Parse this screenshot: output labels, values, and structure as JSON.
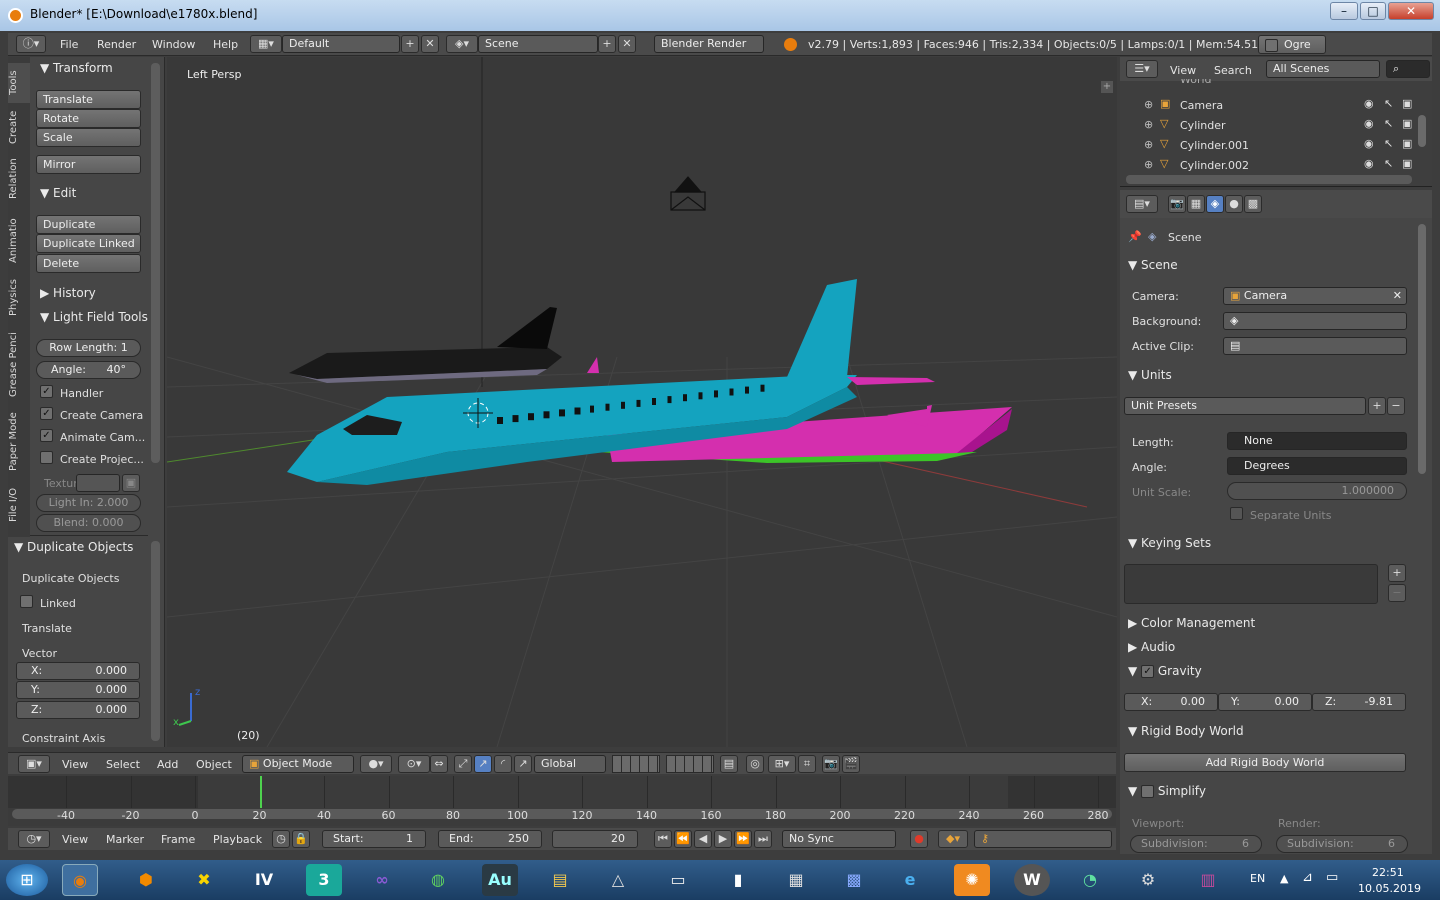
{
  "window": {
    "title": "Blender* [E:\\Download\\e1780x.blend]",
    "min": "–",
    "max": "□",
    "close": "✕"
  },
  "topbar": {
    "menus": [
      "File",
      "Render",
      "Window",
      "Help"
    ],
    "layout": "Default",
    "scene": "Scene",
    "engine": "Blender Render",
    "stats": "v2.79 | Verts:1,893 | Faces:946 | Tris:2,334 | Objects:0/5 | Lamps:0/1 | Mem:54.51M",
    "ogre": "Ogre"
  },
  "vtabs": [
    "Tools",
    "Create",
    "Relation",
    "Animatio",
    "Physics",
    "Grease Penci",
    "Paper Mode",
    "File I/O"
  ],
  "tools": {
    "transform_title": "Transform",
    "translate": "Translate",
    "rotate": "Rotate",
    "scale": "Scale",
    "mirror": "Mirror",
    "edit_title": "Edit",
    "duplicate": "Duplicate",
    "duplicate_linked": "Duplicate Linked",
    "delete": "Delete",
    "history_title": "History",
    "lightfield_title": "Light Field Tools",
    "row_length": "Row Length: 1",
    "angle": "Angle:",
    "angle_val": "40°",
    "handler": "Handler",
    "create_camera": "Create Camera",
    "animate_cam": "Animate Cam...",
    "create_projec": "Create Projec...",
    "textur": "Textur",
    "light_in": "Light In: 2.000",
    "blend": "Blend: 0.000"
  },
  "dup": {
    "title": "Duplicate Objects",
    "label": "Duplicate Objects",
    "linked": "Linked",
    "translate": "Translate",
    "vector": "Vector",
    "x": "X:",
    "xv": "0.000",
    "y": "Y:",
    "yv": "0.000",
    "z": "Z:",
    "zv": "0.000",
    "constraint": "Constraint Axis"
  },
  "viewport": {
    "persp": "Left Persp",
    "frame": "(20)",
    "axis_x": "x",
    "axis_z": "z"
  },
  "outliner": {
    "view": "View",
    "search": "Search",
    "all_scenes": "All Scenes",
    "world": "World",
    "items": [
      "Camera",
      "Cylinder",
      "Cylinder.001",
      "Cylinder.002"
    ]
  },
  "props": {
    "crumb": "Scene",
    "scene_title": "Scene",
    "camera_label": "Camera:",
    "camera_val": "Camera",
    "background": "Background:",
    "active_clip": "Active Clip:",
    "units_title": "Units",
    "unit_presets": "Unit Presets",
    "length": "Length:",
    "length_val": "None",
    "angle": "Angle:",
    "angle_val": "Degrees",
    "unit_scale": "Unit Scale:",
    "unit_scale_val": "1.000000",
    "separate": "Separate Units",
    "keying_title": "Keying Sets",
    "color_mgmt": "Color Management",
    "audio": "Audio",
    "gravity": "Gravity",
    "gx": "X:",
    "gxv": "0.00",
    "gy": "Y:",
    "gyv": "0.00",
    "gz": "Z:",
    "gzv": "-9.81",
    "rigid_title": "Rigid Body World",
    "add_rigid": "Add Rigid Body World",
    "simplify": "Simplify",
    "viewport": "Viewport:",
    "render": "Render:",
    "subdiv": "Subdivision:",
    "subdiv_v": "6",
    "subdiv_r": "6"
  },
  "vpheader": {
    "view": "View",
    "select": "Select",
    "add": "Add",
    "object": "Object",
    "mode": "Object Mode",
    "orient": "Global"
  },
  "timeline": {
    "ticks": [
      "-40",
      "-20",
      "0",
      "20",
      "40",
      "60",
      "80",
      "100",
      "120",
      "140",
      "160",
      "180",
      "200",
      "220",
      "240",
      "260",
      "280"
    ],
    "current": 20
  },
  "tlheader": {
    "view": "View",
    "marker": "Marker",
    "frame": "Frame",
    "playback": "Playback",
    "start": "Start:",
    "start_v": "1",
    "end": "End:",
    "end_v": "250",
    "cur": "20",
    "sync": "No Sync"
  },
  "taskbar": {
    "lang": "EN",
    "time": "22:51",
    "date": "10.05.2019",
    "apps": [
      "Au",
      "IV",
      "3",
      "W"
    ]
  },
  "colors": {
    "plane_body": "#12a2bd",
    "plane_wing": "#d430b5",
    "plane_green": "#36c22a",
    "accent": "#5680c2"
  }
}
